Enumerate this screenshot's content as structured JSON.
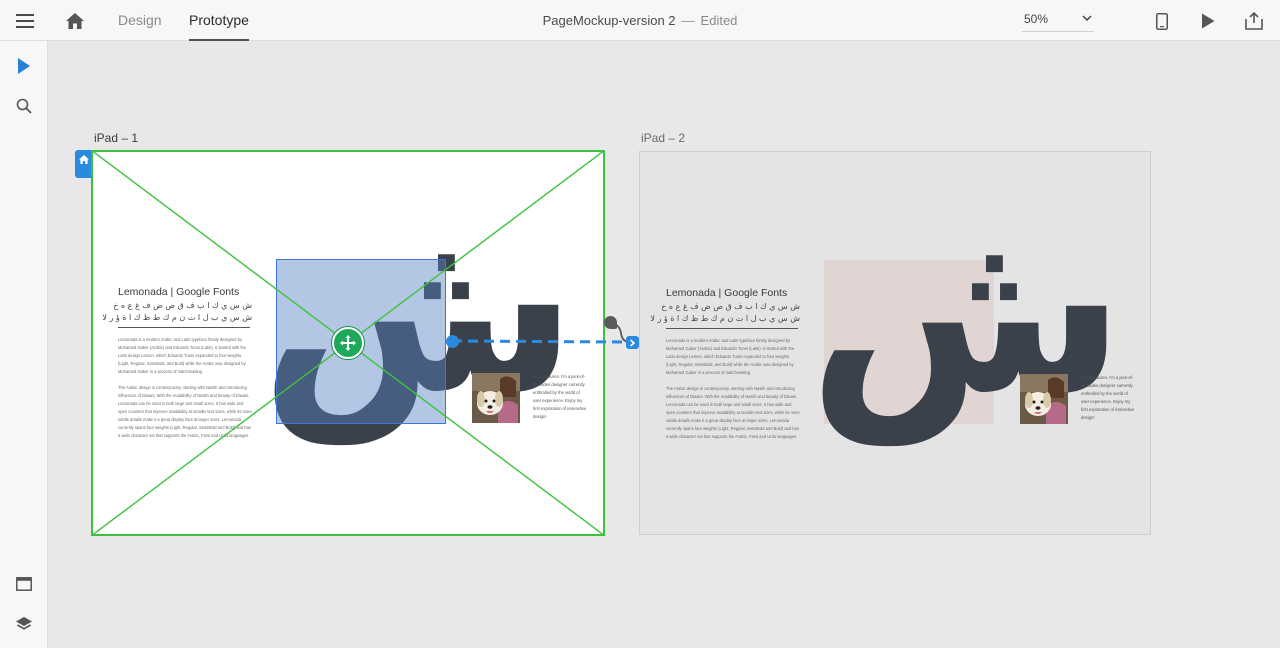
{
  "topbar": {
    "tabs": [
      {
        "label": "Design",
        "active": false
      },
      {
        "label": "Prototype",
        "active": true
      }
    ],
    "document_title": "PageMockup-version 2",
    "separator": "—",
    "status": "Edited",
    "zoom_value": "50%",
    "icons": [
      "hamburger-icon",
      "home-icon",
      "chevron-down-icon",
      "phone-icon",
      "play-icon",
      "share-icon"
    ]
  },
  "leftbar": {
    "icons": [
      "select-arrow-icon",
      "search-icon",
      "assets-icon",
      "layers-icon"
    ]
  },
  "artboards": [
    {
      "label": "iPad – 1",
      "title": "Lemonada | Google Fonts",
      "arabic_line_1": "ش س ي ك ا ب ف ق ص ض ف غ ع ه خ",
      "arabic_line_2": "ش س ي ب ل ا ت ن م ك ط ظ ك ا ة ؤ ر لا",
      "paragraph_1": "Lemonada is a modern Arabic and Latin typeface family designed by Mohamed Gaber (Arabic) and Eduardo Tunni (Latin). It started with the Latin design Lemon, which Eduardo Tunni expanded to four weights (Light, Regular, SemiBold, and Bold) while the Arabic was designed by Mohamed Gaber in a process of matchmaking.",
      "paragraph_2": "The Arabic design is contemporary, starting with Naskh and introducing influences of Diwani. With the readability of Naskh and beauty of Diwani, Lemonada can be used in both large and small sizes. It has wide and open counters that improve readability at smaller text sizes, while its more subtle details make it a great display face at larger sizes. Lemonada currently spans four weights (Light, Regular, SemiBold and Bold) and has a wide character set that supports the Arabic, Farsi and Urdu languages.",
      "glyph": "ش",
      "bio": "Hi, I'm Lauren. I'm a jack-of-all-trades designer currently enthralled by the world of user experience. Enjoy my first exploration of interactive design!"
    },
    {
      "label": "iPad – 2",
      "title": "Lemonada | Google Fonts",
      "arabic_line_1": "ش س ي ك ا ب ف ق ص ض ف غ ع ه خ",
      "arabic_line_2": "ش س ي ب ل ا ت ن م ك ط ظ ك ا ة ؤ ر لا",
      "paragraph_1": "Lemonada is a modern Arabic and Latin typeface family designed by Mohamed Gaber (Arabic) and Eduardo Tunni (Latin). It started with the Latin design Lemon, which Eduardo Tunni expanded to four weights (Light, Regular, SemiBold, and Bold) while the Arabic was designed by Mohamed Gaber in a process of matchmaking.",
      "paragraph_2": "The Arabic design is contemporary, starting with Naskh and introducing influences of Diwani. With the readability of Naskh and beauty of Diwani, Lemonada can be used in both large and small sizes. It has wide and open counters that improve readability at smaller text sizes, while its more subtle details make it a great display face at larger sizes. Lemonada currently spans four weights (Light, Regular, SemiBold and Bold) and has a wide character set that supports the Arabic, Farsi and Urdu languages.",
      "glyph": "ش",
      "bio": "Hi, I'm Lauren. I'm a jack-of-all-trades designer currently enthralled by the world of user experience. Enjoy my first exploration of interactive design!"
    }
  ],
  "colors": {
    "selection_green": "#3ec13e",
    "link_blue": "#2a8ae0",
    "selected_fill": "#5680c4",
    "glyph": "#3a414a",
    "pink_square": "#e0d5d3"
  }
}
